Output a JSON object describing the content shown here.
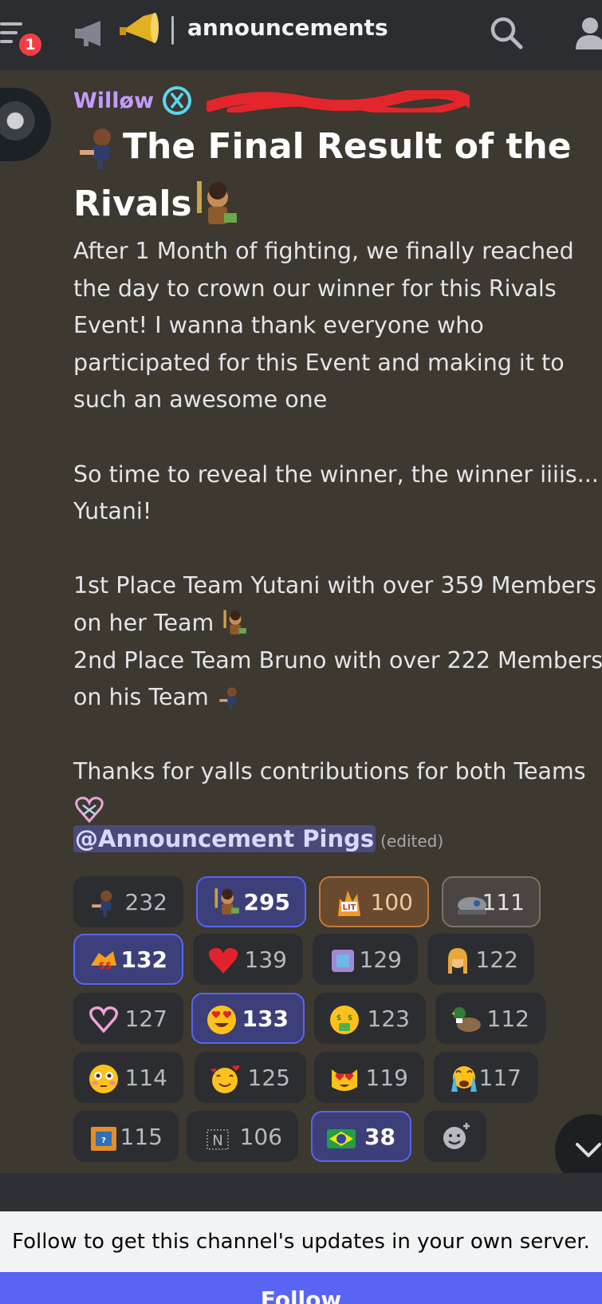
{
  "header": {
    "notification_count": "1",
    "channel_name": "announcements",
    "icons": [
      "menu-icon",
      "megaphone-icon",
      "horn-emoji-icon",
      "search-icon",
      "members-icon"
    ]
  },
  "message": {
    "author": "Willøw",
    "author_color": "#c39bff",
    "title_line1": "The Final Result of the",
    "title_line2": "Rivals",
    "paragraph1": [
      "After 1 Month of fighting, we finally reached",
      "the day to crown our winner for this Rivals",
      "Event! I wanna thank everyone who",
      "participated for this Event and making it to",
      "such an awesome one"
    ],
    "paragraph2": [
      "So time to reveal the winner, the winner iiiis...",
      "Yutani!"
    ],
    "place1_line1": "1st Place Team Yutani with over 359 Members",
    "place1_line2": "on her Team",
    "place2_line1": " 2nd Place Team Bruno with over 222 Members",
    "place2_line2": "on his Team",
    "thanks_line": "Thanks for yalls contributions for both Teams",
    "mention": "@Announcement Pings",
    "edited": "(edited)"
  },
  "reactions": [
    [
      {
        "emoji": "bruno-emoji",
        "count": "232",
        "state": "normal"
      },
      {
        "emoji": "yutani-emoji",
        "count": "295",
        "state": "me"
      },
      {
        "emoji": "lit-emoji",
        "count": "100",
        "state": "orange"
      },
      {
        "emoji": "peeking-emoji",
        "count": "111",
        "state": "gray"
      }
    ],
    [
      {
        "emoji": "boosts-emoji",
        "count": "132",
        "state": "me"
      },
      {
        "emoji": "red-heart-emoji",
        "count": "139",
        "state": "normal"
      },
      {
        "emoji": "picture-emoji",
        "count": "129",
        "state": "normal"
      },
      {
        "emoji": "girl-emoji",
        "count": "122",
        "state": "normal"
      }
    ],
    [
      {
        "emoji": "pink-heart-emoji",
        "count": "127",
        "state": "normal"
      },
      {
        "emoji": "heart-eyes-emoji",
        "count": "133",
        "state": "me"
      },
      {
        "emoji": "money-mouth-emoji",
        "count": "123",
        "state": "normal"
      },
      {
        "emoji": "duck-emoji",
        "count": "112",
        "state": "normal"
      }
    ],
    [
      {
        "emoji": "flushed-emoji",
        "count": "114",
        "state": "normal"
      },
      {
        "emoji": "smiling-hearts-emoji",
        "count": "125",
        "state": "normal"
      },
      {
        "emoji": "heart-eyes-cat-emoji",
        "count": "119",
        "state": "normal"
      },
      {
        "emoji": "crying-emoji",
        "count": "117",
        "state": "normal"
      }
    ],
    [
      {
        "emoji": "crate-emoji",
        "count": "115",
        "state": "normal"
      },
      {
        "emoji": "n-letter-emoji",
        "count": "106",
        "state": "normal"
      },
      {
        "emoji": "brazil-flag-emoji",
        "count": "38",
        "state": "me"
      }
    ]
  ],
  "footer": {
    "banner_text": "Follow to get this channel's updates in your own server.",
    "follow_label": "Follow"
  }
}
